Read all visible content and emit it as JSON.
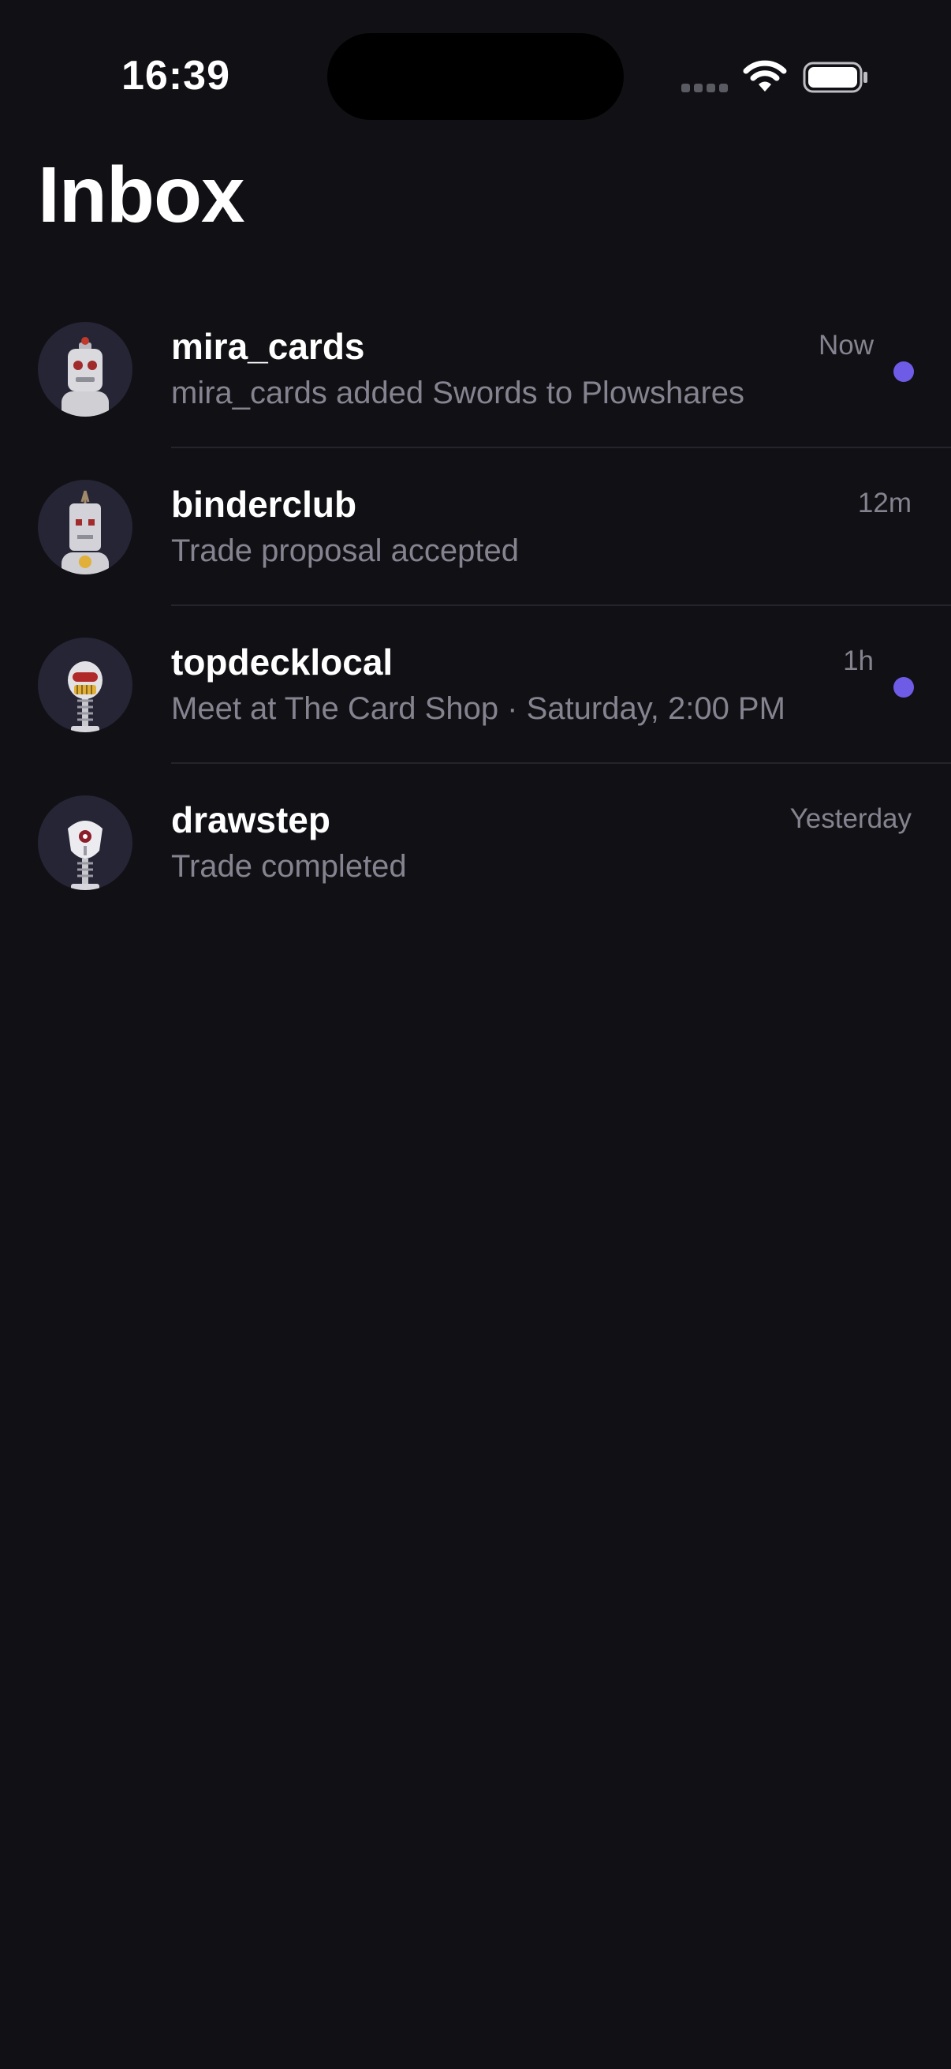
{
  "status_bar": {
    "time": "16:39"
  },
  "colors": {
    "background": "#111015",
    "accent_unread": "#6e5ce6",
    "secondary_text": "#85838f"
  },
  "header": {
    "title": "Inbox"
  },
  "conversations": [
    {
      "username": "mira_cards",
      "preview": "mira_cards added Swords to Plowshares",
      "time": "Now",
      "unread": true,
      "avatar_icon": "robot-avatar-icon"
    },
    {
      "username": "binderclub",
      "preview": "Trade proposal accepted",
      "time": "12m",
      "unread": false,
      "avatar_icon": "robot-avatar-icon"
    },
    {
      "username": "topdecklocal",
      "preview": "Meet at The Card Shop · Saturday, 2:00 PM",
      "time": "1h",
      "unread": true,
      "avatar_icon": "robot-avatar-icon"
    },
    {
      "username": "drawstep",
      "preview": "Trade completed",
      "time": "Yesterday",
      "unread": false,
      "avatar_icon": "robot-avatar-icon"
    }
  ]
}
